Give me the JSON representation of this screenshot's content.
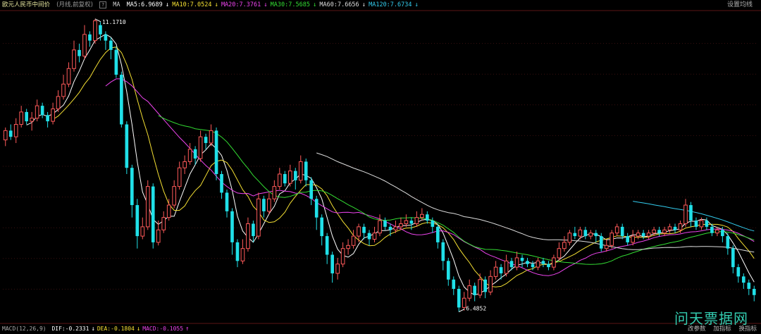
{
  "header": {
    "title": "欧元人民币中间价",
    "subtitle": "(月线,前复权)",
    "help_icon": "?",
    "ma_prefix": "MA",
    "ma_items": [
      {
        "label": "MA5:6.9689",
        "arrow": "↓",
        "color": "#ffffff"
      },
      {
        "label": "MA10:7.0524",
        "arrow": "↓",
        "color": "#f5e033"
      },
      {
        "label": "MA20:7.3761",
        "arrow": "↓",
        "color": "#ee44ee"
      },
      {
        "label": "MA30:7.5685",
        "arrow": "↓",
        "color": "#33dd33"
      },
      {
        "label": "MA60:7.6656",
        "arrow": "↓",
        "color": "#dddddd"
      },
      {
        "label": "MA120:7.6734",
        "arrow": "↓",
        "color": "#33ccee"
      }
    ],
    "settings_button": "设置均线"
  },
  "footer": {
    "macd_label": "MACD(12,26,9)",
    "items": [
      {
        "label": "DIF:-0.2331",
        "arrow": "↓",
        "color": "#ffffff"
      },
      {
        "label": "DEA:-0.1804",
        "arrow": "↓",
        "color": "#f5e033"
      },
      {
        "label": "MACD:-0.1055",
        "arrow": "↑",
        "color": "#ee44ee"
      }
    ],
    "buttons": [
      "改参数",
      "加指标",
      "换指标"
    ]
  },
  "watermark": "问天票据网",
  "chart_data": {
    "type": "candlestick",
    "up_color": "#ff5a5a",
    "down_color": "#20e0e8",
    "y_range": [
      6.35,
      11.3
    ],
    "max_label": "11.1710",
    "min_label": "6.4852",
    "candles": [
      [
        9.25,
        9.4,
        9.15,
        9.45
      ],
      [
        9.4,
        9.3,
        9.25,
        9.5
      ],
      [
        9.3,
        9.5,
        9.2,
        9.6
      ],
      [
        9.5,
        9.7,
        9.45,
        9.8
      ],
      [
        9.7,
        9.55,
        9.5,
        9.75
      ],
      [
        9.55,
        9.6,
        9.4,
        9.7
      ],
      [
        9.6,
        9.8,
        9.55,
        9.9
      ],
      [
        9.8,
        9.65,
        9.6,
        9.85
      ],
      [
        9.65,
        9.55,
        9.45,
        9.7
      ],
      [
        9.55,
        9.75,
        9.5,
        9.85
      ],
      [
        9.75,
        9.95,
        9.7,
        10.05
      ],
      [
        9.95,
        10.15,
        9.9,
        10.3
      ],
      [
        10.15,
        10.4,
        10.1,
        10.5
      ],
      [
        10.4,
        10.7,
        10.35,
        10.85
      ],
      [
        10.7,
        10.6,
        10.5,
        10.8
      ],
      [
        10.6,
        10.95,
        10.55,
        11.1
      ],
      [
        10.95,
        10.85,
        10.75,
        11.0
      ],
      [
        10.85,
        11.17,
        10.8,
        11.2
      ],
      [
        11.1,
        10.95,
        10.85,
        11.15
      ],
      [
        10.95,
        10.85,
        10.7,
        11.0
      ],
      [
        10.85,
        10.7,
        10.55,
        10.9
      ],
      [
        10.7,
        10.3,
        10.25,
        10.75
      ],
      [
        10.3,
        9.5,
        9.45,
        10.35
      ],
      [
        9.5,
        8.8,
        8.7,
        9.55
      ],
      [
        8.8,
        8.2,
        8.0,
        8.85
      ],
      [
        8.2,
        7.7,
        7.5,
        8.3
      ],
      [
        7.7,
        7.85,
        7.65,
        8.0
      ],
      [
        7.85,
        8.5,
        7.8,
        8.6
      ],
      [
        8.5,
        7.6,
        7.5,
        8.55
      ],
      [
        7.6,
        7.8,
        7.55,
        7.95
      ],
      [
        7.8,
        8.0,
        7.75,
        8.1
      ],
      [
        8.0,
        8.2,
        7.95,
        8.3
      ],
      [
        8.2,
        8.5,
        8.15,
        8.6
      ],
      [
        8.5,
        8.8,
        8.45,
        8.9
      ],
      [
        8.8,
        8.9,
        8.7,
        9.0
      ],
      [
        8.9,
        9.1,
        8.85,
        9.2
      ],
      [
        9.1,
        8.95,
        8.85,
        9.15
      ],
      [
        8.95,
        9.3,
        8.9,
        9.4
      ],
      [
        9.3,
        9.2,
        9.1,
        9.35
      ],
      [
        9.2,
        9.4,
        9.15,
        9.5
      ],
      [
        9.4,
        8.7,
        8.6,
        9.45
      ],
      [
        8.7,
        8.4,
        8.3,
        8.75
      ],
      [
        8.4,
        8.1,
        8.0,
        8.45
      ],
      [
        8.1,
        7.6,
        7.4,
        8.15
      ],
      [
        7.6,
        7.3,
        7.2,
        7.65
      ],
      [
        7.3,
        7.5,
        7.25,
        7.65
      ],
      [
        7.5,
        7.9,
        7.45,
        8.0
      ],
      [
        7.9,
        7.7,
        7.6,
        7.95
      ],
      [
        7.7,
        8.3,
        7.65,
        8.4
      ],
      [
        8.3,
        8.1,
        8.0,
        8.35
      ],
      [
        8.1,
        8.3,
        8.05,
        8.4
      ],
      [
        8.3,
        8.5,
        8.25,
        8.6
      ],
      [
        8.5,
        8.7,
        8.45,
        8.8
      ],
      [
        8.7,
        8.55,
        8.5,
        8.75
      ],
      [
        8.55,
        8.75,
        8.5,
        8.85
      ],
      [
        8.75,
        8.6,
        8.45,
        8.8
      ],
      [
        8.6,
        8.9,
        8.55,
        9.0
      ],
      [
        8.9,
        8.6,
        8.5,
        8.95
      ],
      [
        8.6,
        8.3,
        8.2,
        8.65
      ],
      [
        8.3,
        8.0,
        7.8,
        8.35
      ],
      [
        8.0,
        7.7,
        7.55,
        8.05
      ],
      [
        7.7,
        7.4,
        7.25,
        7.75
      ],
      [
        7.4,
        7.1,
        6.95,
        7.45
      ],
      [
        7.1,
        7.25,
        7.0,
        7.35
      ],
      [
        7.25,
        7.5,
        7.2,
        7.6
      ],
      [
        7.5,
        7.55,
        7.4,
        7.65
      ],
      [
        7.55,
        7.7,
        7.5,
        7.8
      ],
      [
        7.7,
        7.85,
        7.6,
        7.9
      ],
      [
        7.85,
        7.75,
        7.65,
        7.9
      ],
      [
        7.75,
        7.65,
        7.55,
        7.8
      ],
      [
        7.65,
        7.75,
        7.6,
        7.85
      ],
      [
        7.75,
        7.95,
        7.7,
        8.05
      ],
      [
        7.95,
        7.85,
        7.8,
        8.0
      ],
      [
        7.85,
        7.8,
        7.7,
        7.9
      ],
      [
        7.8,
        7.85,
        7.75,
        7.95
      ],
      [
        7.85,
        7.9,
        7.8,
        8.0
      ],
      [
        7.9,
        7.95,
        7.85,
        8.05
      ],
      [
        7.95,
        7.9,
        7.8,
        8.0
      ],
      [
        7.9,
        8.0,
        7.85,
        8.1
      ],
      [
        8.0,
        8.05,
        7.95,
        8.15
      ],
      [
        8.05,
        7.95,
        7.9,
        8.1
      ],
      [
        7.95,
        7.85,
        7.75,
        8.0
      ],
      [
        7.85,
        7.6,
        7.5,
        7.9
      ],
      [
        7.6,
        7.3,
        7.15,
        7.65
      ],
      [
        7.3,
        7.0,
        6.9,
        7.35
      ],
      [
        7.0,
        6.85,
        6.75,
        7.05
      ],
      [
        6.85,
        6.55,
        6.48,
        6.9
      ],
      [
        6.55,
        6.7,
        6.5,
        6.8
      ],
      [
        6.7,
        6.9,
        6.65,
        7.0
      ],
      [
        6.9,
        6.75,
        6.65,
        6.95
      ],
      [
        6.75,
        7.0,
        6.7,
        7.1
      ],
      [
        7.0,
        6.8,
        6.7,
        7.05
      ],
      [
        6.8,
        7.05,
        6.75,
        7.15
      ],
      [
        7.05,
        7.2,
        7.0,
        7.3
      ],
      [
        7.2,
        7.1,
        7.0,
        7.25
      ],
      [
        7.1,
        7.3,
        7.05,
        7.4
      ],
      [
        7.3,
        7.2,
        7.15,
        7.35
      ],
      [
        7.2,
        7.35,
        7.15,
        7.45
      ],
      [
        7.35,
        7.3,
        7.2,
        7.4
      ],
      [
        7.3,
        7.25,
        7.2,
        7.35
      ],
      [
        7.25,
        7.2,
        7.15,
        7.3
      ],
      [
        7.2,
        7.3,
        7.15,
        7.35
      ],
      [
        7.3,
        7.25,
        7.2,
        7.35
      ],
      [
        7.25,
        7.2,
        7.15,
        7.3
      ],
      [
        7.2,
        7.35,
        7.15,
        7.4
      ],
      [
        7.35,
        7.5,
        7.3,
        7.6
      ],
      [
        7.5,
        7.6,
        7.45,
        7.7
      ],
      [
        7.6,
        7.75,
        7.55,
        7.8
      ],
      [
        7.75,
        7.7,
        7.65,
        7.85
      ],
      [
        7.7,
        7.8,
        7.65,
        7.85
      ],
      [
        7.8,
        7.7,
        7.65,
        7.85
      ],
      [
        7.7,
        7.75,
        7.65,
        7.8
      ],
      [
        7.75,
        7.7,
        7.6,
        7.8
      ],
      [
        7.7,
        7.5,
        7.45,
        7.75
      ],
      [
        7.5,
        7.55,
        7.45,
        7.65
      ],
      [
        7.55,
        7.75,
        7.5,
        7.8
      ],
      [
        7.75,
        7.85,
        7.7,
        7.9
      ],
      [
        7.85,
        7.7,
        7.65,
        7.9
      ],
      [
        7.7,
        7.6,
        7.55,
        7.75
      ],
      [
        7.6,
        7.7,
        7.55,
        7.8
      ],
      [
        7.7,
        7.75,
        7.65,
        7.8
      ],
      [
        7.75,
        7.7,
        7.65,
        7.8
      ],
      [
        7.7,
        7.75,
        7.65,
        7.8
      ],
      [
        7.75,
        7.8,
        7.7,
        7.85
      ],
      [
        7.8,
        7.75,
        7.7,
        7.85
      ],
      [
        7.75,
        7.8,
        7.7,
        7.85
      ],
      [
        7.8,
        7.85,
        7.75,
        7.9
      ],
      [
        7.85,
        7.8,
        7.75,
        7.9
      ],
      [
        7.8,
        7.9,
        7.75,
        7.95
      ],
      [
        7.9,
        8.2,
        7.85,
        8.3
      ],
      [
        8.2,
        7.95,
        7.85,
        8.25
      ],
      [
        7.95,
        7.85,
        7.8,
        8.0
      ],
      [
        7.85,
        7.95,
        7.8,
        8.0
      ],
      [
        7.95,
        7.85,
        7.8,
        8.0
      ],
      [
        7.85,
        7.75,
        7.7,
        7.9
      ],
      [
        7.75,
        7.8,
        7.7,
        7.85
      ],
      [
        7.8,
        7.7,
        7.6,
        7.85
      ],
      [
        7.7,
        7.5,
        7.4,
        7.75
      ],
      [
        7.5,
        7.2,
        7.1,
        7.55
      ],
      [
        7.2,
        7.05,
        6.95,
        7.25
      ],
      [
        7.05,
        6.95,
        6.85,
        7.1
      ],
      [
        6.95,
        6.85,
        6.75,
        7.0
      ],
      [
        6.85,
        6.75,
        6.65,
        6.9
      ]
    ],
    "ma": [
      {
        "name": "MA5",
        "period": 5,
        "color": "#ffffff"
      },
      {
        "name": "MA10",
        "period": 10,
        "color": "#f5e033"
      },
      {
        "name": "MA20",
        "period": 20,
        "color": "#ee44ee"
      },
      {
        "name": "MA30",
        "period": 30,
        "color": "#33dd33"
      },
      {
        "name": "MA60",
        "period": 60,
        "color": "#dddddd"
      },
      {
        "name": "MA120",
        "period": 120,
        "color": "#33ccee"
      }
    ]
  }
}
